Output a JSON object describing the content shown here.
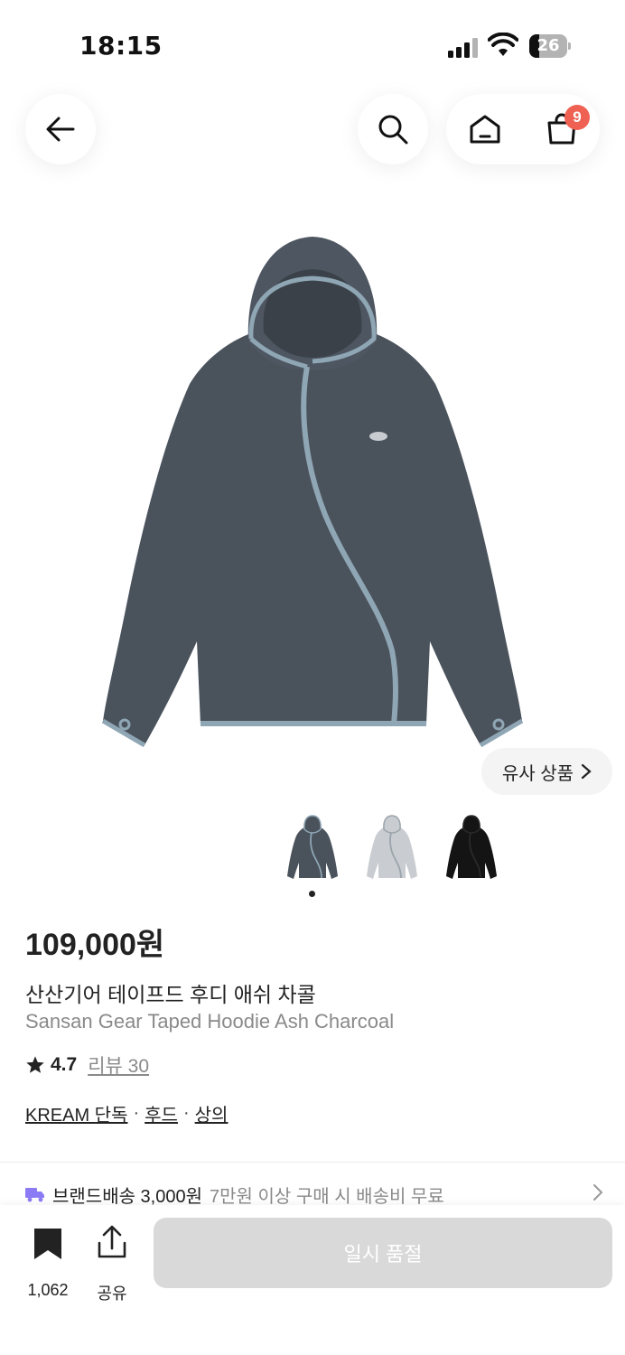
{
  "status_bar": {
    "time": "18:15",
    "battery_level": "26",
    "battery_fraction": 0.26
  },
  "nav": {
    "cart_badge": "9"
  },
  "product": {
    "similar_label": "유사 상품",
    "thumbnails": [
      {
        "color": "#4a525c",
        "tape": "#8fa6b4"
      },
      {
        "color": "#c9cdd2",
        "tape": "#9aa4ab"
      },
      {
        "color": "#141414",
        "tape": "#2a2a2a"
      }
    ],
    "price": "109,000원",
    "name_ko": "산산기어 테이프드 후디 애쉬 차콜",
    "name_en": "Sansan Gear Taped Hoodie Ash Charcoal",
    "rating": "4.7",
    "review": "리뷰 30",
    "tags": [
      "KREAM 단독",
      "후드",
      "상의"
    ],
    "tag_separator": "·"
  },
  "shipping": {
    "label": "브랜드배송 3,000원",
    "note": "7만원 이상 구매 시 배송비 무료"
  },
  "bottom_bar": {
    "bookmark_count": "1,062",
    "share_label": "공유",
    "action_label": "일시 품절"
  },
  "colors": {
    "hoodie": "#4a525c",
    "tape": "#8fa6b4",
    "badge": "#ef6253",
    "shipping_icon": "#8b7cf6",
    "disabled_button": "#d9d9d9"
  }
}
